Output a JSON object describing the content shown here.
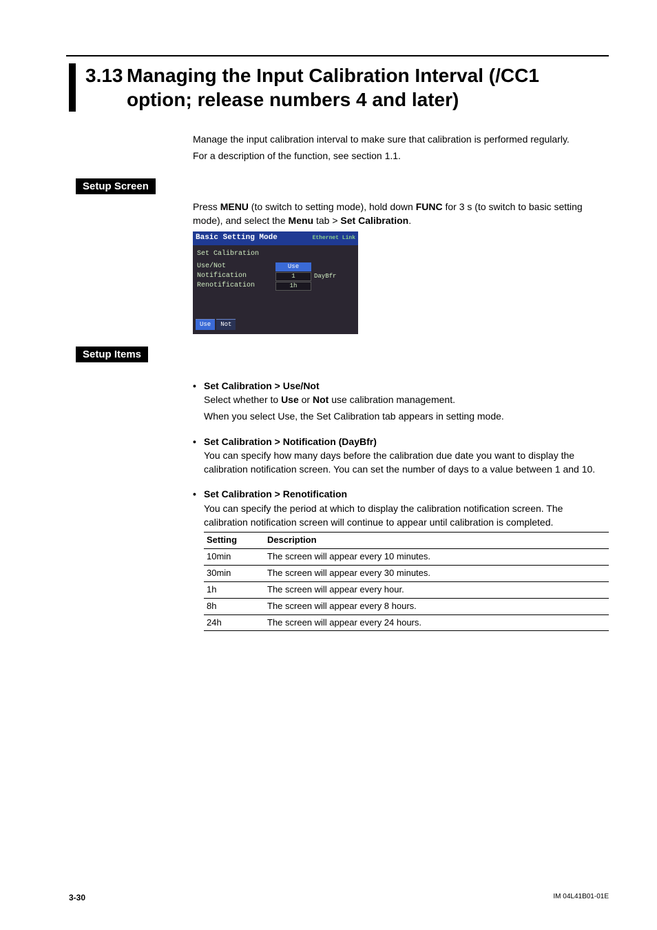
{
  "heading": {
    "number": "3.13",
    "title": "Managing the Input Calibration Interval (/CC1 option; release numbers 4 and later)"
  },
  "intro": {
    "line1": "Manage the input calibration interval to make sure that calibration is performed regularly.",
    "line2": "For a description of the function, see section 1.1."
  },
  "setup_screen": {
    "label": "Setup Screen",
    "instr_prefix": "Press ",
    "menu": "MENU",
    "instr_mid1": " (to switch to setting mode), hold down ",
    "func": "FUNC",
    "instr_mid2": " for 3 s (to switch to basic setting mode), and select the ",
    "menu_tab": "Menu",
    "instr_mid3": " tab > ",
    "set_cal": "Set Calibration",
    "instr_end": "."
  },
  "device": {
    "header": "Basic Setting Mode",
    "header_right": "Ethernet\nLink",
    "title": "Set Calibration",
    "rows": [
      {
        "label": "Use/Not",
        "value": "Use",
        "selected": true,
        "unit": ""
      },
      {
        "label": "Notification",
        "value": "1",
        "selected": false,
        "unit": "DayBfr"
      },
      {
        "label": "Renotification",
        "value": "1h",
        "selected": false,
        "unit": ""
      }
    ],
    "buttons": [
      "Use",
      "Not"
    ]
  },
  "setup_items": {
    "label": "Setup Items",
    "items": [
      {
        "head": "Set Calibration > Use/Not",
        "lines": [
          {
            "pre": "Select whether to ",
            "b1": "Use",
            "mid": " or ",
            "b2": "Not",
            "post": " use calibration management."
          },
          {
            "plain": "When you select Use, the Set Calibration tab appears in setting mode."
          }
        ]
      },
      {
        "head": "Set Calibration > Notification (DayBfr)",
        "lines": [
          {
            "plain": "You can specify how many days before the calibration due date you want to display the calibration notification screen. You can set the number of days to a value between 1 and 10."
          }
        ]
      },
      {
        "head": "Set Calibration > Renotification",
        "lines": [
          {
            "plain": "You can specify the period at which to display the calibration notification screen. The calibration notification screen will continue to appear until calibration is completed."
          }
        ]
      }
    ]
  },
  "table": {
    "headers": [
      "Setting",
      "Description"
    ],
    "rows": [
      [
        "10min",
        "The screen will appear every 10 minutes."
      ],
      [
        "30min",
        "The screen will appear every 30 minutes."
      ],
      [
        "1h",
        "The screen will appear every hour."
      ],
      [
        "8h",
        "The screen will appear every 8 hours."
      ],
      [
        "24h",
        "The screen will appear every 24 hours."
      ]
    ]
  },
  "footer": {
    "page": "3-30",
    "docid": "IM 04L41B01-01E"
  }
}
